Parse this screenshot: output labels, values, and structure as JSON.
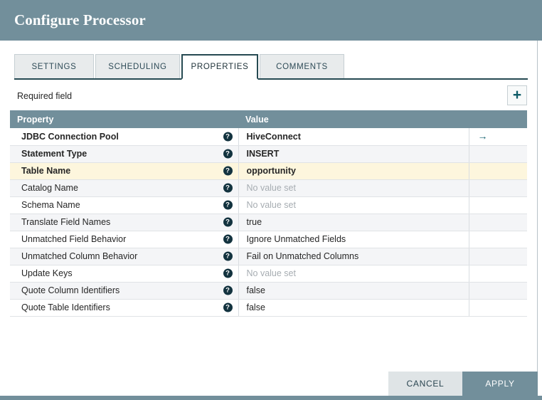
{
  "dialog": {
    "title": "Configure Processor"
  },
  "tabs": [
    {
      "id": "settings",
      "label": "SETTINGS",
      "active": false
    },
    {
      "id": "scheduling",
      "label": "SCHEDULING",
      "active": false
    },
    {
      "id": "properties",
      "label": "PROPERTIES",
      "active": true
    },
    {
      "id": "comments",
      "label": "COMMENTS",
      "active": false
    }
  ],
  "toolbar": {
    "required_field_label": "Required field",
    "add_button_glyph": "+",
    "add_button_name": "add-property-button"
  },
  "table": {
    "headers": {
      "property": "Property",
      "value": "Value",
      "actions": ""
    },
    "help_glyph": "?",
    "go_arrow_glyph": "→",
    "rows": [
      {
        "property": "JDBC Connection Pool",
        "value": "HiveConnect",
        "required": true,
        "empty": false,
        "highlight": false,
        "has_arrow": true
      },
      {
        "property": "Statement Type",
        "value": "INSERT",
        "required": true,
        "empty": false,
        "highlight": false,
        "has_arrow": false
      },
      {
        "property": "Table Name",
        "value": "opportunity",
        "required": true,
        "empty": false,
        "highlight": true,
        "has_arrow": false
      },
      {
        "property": "Catalog Name",
        "value": "No value set",
        "required": false,
        "empty": true,
        "highlight": false,
        "has_arrow": false
      },
      {
        "property": "Schema Name",
        "value": "No value set",
        "required": false,
        "empty": true,
        "highlight": false,
        "has_arrow": false
      },
      {
        "property": "Translate Field Names",
        "value": "true",
        "required": false,
        "empty": false,
        "highlight": false,
        "has_arrow": false
      },
      {
        "property": "Unmatched Field Behavior",
        "value": "Ignore Unmatched Fields",
        "required": false,
        "empty": false,
        "highlight": false,
        "has_arrow": false
      },
      {
        "property": "Unmatched Column Behavior",
        "value": "Fail on Unmatched Columns",
        "required": false,
        "empty": false,
        "highlight": false,
        "has_arrow": false
      },
      {
        "property": "Update Keys",
        "value": "No value set",
        "required": false,
        "empty": true,
        "highlight": false,
        "has_arrow": false
      },
      {
        "property": "Quote Column Identifiers",
        "value": "false",
        "required": false,
        "empty": false,
        "highlight": false,
        "has_arrow": false
      },
      {
        "property": "Quote Table Identifiers",
        "value": "false",
        "required": false,
        "empty": false,
        "highlight": false,
        "has_arrow": false
      }
    ]
  },
  "footer": {
    "cancel_label": "CANCEL",
    "apply_label": "APPLY"
  },
  "colors": {
    "header_bar": "#728f9b",
    "table_header": "#728f9b",
    "active_tab_border": "#264a52",
    "highlight_row": "#fdf6dd",
    "stripe_row": "#f4f5f7",
    "apply_button": "#728f9b",
    "cancel_button": "#dfe4e6",
    "help_icon": "#13333f",
    "plus_icon": "#0f5c68",
    "arrow_icon": "#14616e"
  }
}
